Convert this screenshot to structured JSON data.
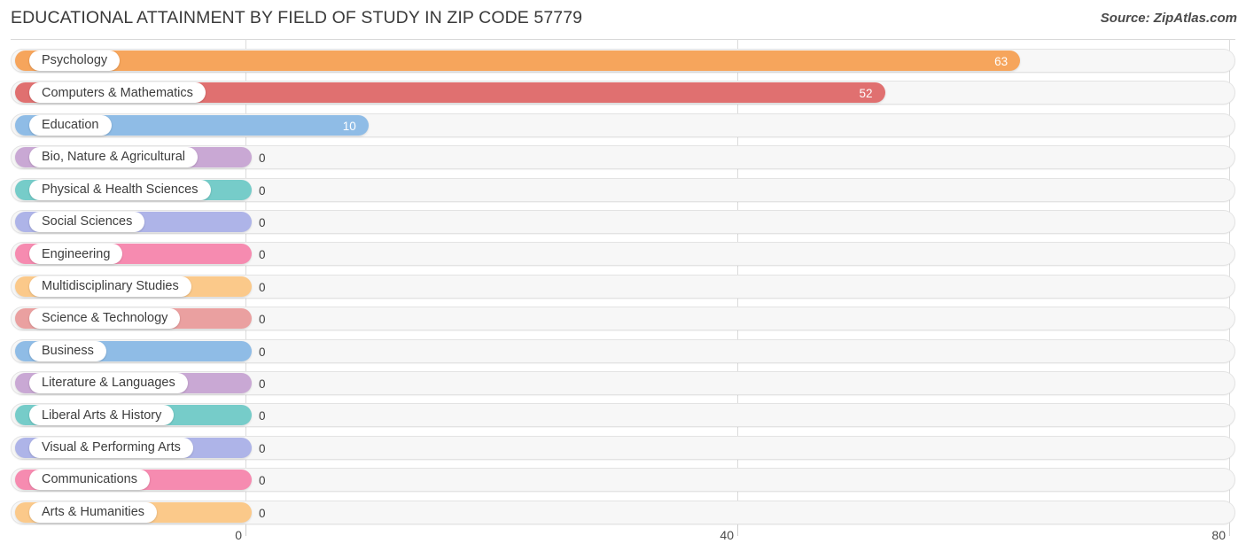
{
  "header": {
    "title": "EDUCATIONAL ATTAINMENT BY FIELD OF STUDY IN ZIP CODE 57779",
    "source": "Source: ZipAtlas.com"
  },
  "chart_data": {
    "type": "bar",
    "orientation": "horizontal",
    "title": "EDUCATIONAL ATTAINMENT BY FIELD OF STUDY IN ZIP CODE 57779",
    "xlabel": "",
    "ylabel": "",
    "xlim": [
      0,
      80
    ],
    "xticks": [
      0,
      40,
      80
    ],
    "xtick_labels": [
      "0",
      "40",
      "80"
    ],
    "grid": true,
    "legend": false,
    "categories": [
      "Psychology",
      "Computers & Mathematics",
      "Education",
      "Bio, Nature & Agricultural",
      "Physical & Health Sciences",
      "Social Sciences",
      "Engineering",
      "Multidisciplinary Studies",
      "Science & Technology",
      "Business",
      "Literature & Languages",
      "Liberal Arts & History",
      "Visual & Performing Arts",
      "Communications",
      "Arts & Humanities"
    ],
    "values": [
      63,
      52,
      10,
      0,
      0,
      0,
      0,
      0,
      0,
      0,
      0,
      0,
      0,
      0,
      0
    ],
    "value_labels": [
      "63",
      "52",
      "10",
      "0",
      "0",
      "0",
      "0",
      "0",
      "0",
      "0",
      "0",
      "0",
      "0",
      "0",
      "0"
    ],
    "colors": [
      "#f6a council",
      "#e07070",
      "#8fbce6",
      "#c9a8d4",
      "#76ccc9",
      "#aeb4e8",
      "#f68bb0",
      "#fbc98a",
      "#eaa0a0",
      "#8fbce6",
      "#c9a8d4",
      "#76ccc9",
      "#aeb4e8",
      "#f68bb0",
      "#fbc98a"
    ]
  }
}
